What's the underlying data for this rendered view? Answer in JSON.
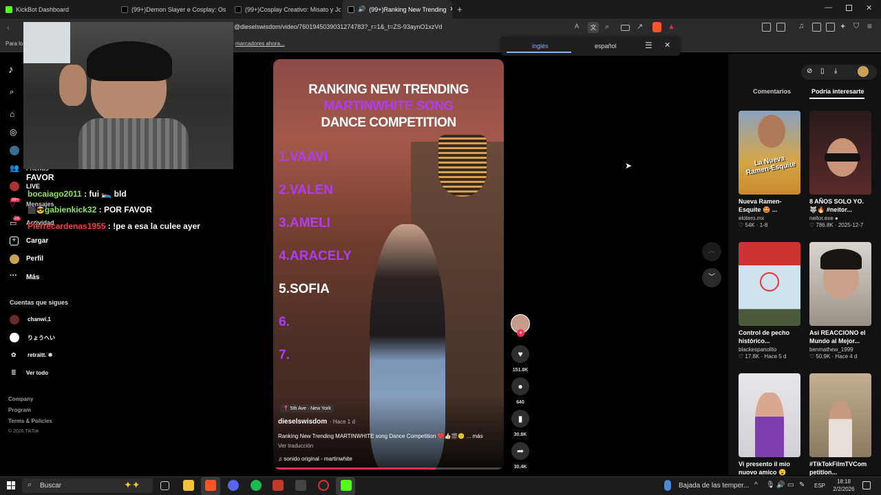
{
  "tabs": [
    {
      "label": "KickBot Dashboard"
    },
    {
      "label": "(99+)Demon Slayer e Cosplay: Os Fa"
    },
    {
      "label": "(99+)Cosplay Creativo: Misato y Jolyr"
    },
    {
      "label": "(99+)Ranking New Trending"
    }
  ],
  "address": {
    "url": "@dieselswisdom/video/7601945039031274783?_r=1&_t=ZS-93aynO1xzVd"
  },
  "bookmarks": {
    "left": "Para lo",
    "prompt": "marcadores ahora..."
  },
  "translate": {
    "lang_from": "inglés",
    "lang_to": "español"
  },
  "left_nav": {
    "items": [
      "Friends",
      "LIVE",
      "Mensajes",
      "Actividad",
      "Cargar",
      "Perfil",
      "Más"
    ],
    "badges": [
      "99+",
      "26"
    ],
    "following_title": "Cuentas que sigues",
    "following": [
      "chanwi.1",
      "りょうへい",
      "retraitt. ❄"
    ],
    "see_all": "Ver todo",
    "footer": [
      "Company",
      "Program",
      "Terms & Policies",
      "© 2026 TikTok"
    ]
  },
  "chat": [
    {
      "user": "",
      "msg": "FAVOR",
      "color": "#ffffff"
    },
    {
      "user": "bocaiago2011",
      "msg": ": fui 🛌 bld",
      "color": "#8ae65c"
    },
    {
      "user": "gabienkick32",
      "msg": ": POR FAVOR",
      "color": "#8ae65c"
    },
    {
      "user": "Pierrecardenas1955",
      "msg": ": !pe a esa la culee ayer",
      "color": "#ff3b3b"
    }
  ],
  "video": {
    "title_lines": [
      "RANKING NEW TRENDING",
      "MARTINWHITE SONG",
      "DANCE COMPETITION"
    ],
    "ranks": [
      "1.VAAVI",
      "2.VALEN",
      "3.AMELI",
      "4.ARACELY",
      "5.SOFIA",
      "6.",
      "7."
    ],
    "location": "5th Ave · New York",
    "author": "dieselswisdom",
    "time": "· Hace 1 d",
    "caption": "Ranking New Trending MARTINWHITE song Dance Competition ❤️👍🏻🎬🙂 ... más",
    "translate_link": "Ver traducción",
    "sound": "sonido original - martinwhite",
    "progress": 0.7
  },
  "actions": {
    "likes": "151.8K",
    "comments": "640",
    "saves": "30.8K",
    "shares": "30.4K"
  },
  "right_panel": {
    "tab_comments": "Comentarios",
    "tab_suggest": "Podría interesarte",
    "cards": [
      {
        "title": "Nueva Ramen-Esquite 🤩 ...",
        "author": "elotero.mx",
        "meta": "♡ 54K · 1-8",
        "overlay": "La Nueva Ramen-Esquite"
      },
      {
        "title": "8 AÑOS SOLO YO. 🐺🔥 #neitor...",
        "author": "neitor.exe ●",
        "meta": "♡ 786.8K · 2025-12-7",
        "overlay": ""
      },
      {
        "title": "Control de pecho histórico...",
        "author": "blackespanolito",
        "meta": "♡ 17.8K · Hace 5 d",
        "overlay": ""
      },
      {
        "title": "Así REACCIONO el Mundo al Mejor...",
        "author": "benmathew_1999",
        "meta": "♡ 50.9K · Hace 4 d",
        "overlay": ""
      },
      {
        "title": "Vi presento il mio nuovo amico 😮",
        "author": "",
        "meta": "",
        "overlay": ""
      },
      {
        "title": "#TikTokFilmTVCom petition...",
        "author": "",
        "meta": "",
        "overlay": ""
      }
    ]
  },
  "taskbar": {
    "search": "Buscar",
    "weather": "Bajada de las temper...",
    "lang": "ESP",
    "time": "18:18",
    "date": "2/2/2026"
  },
  "colors": {
    "accent_purple": "#b13cf0",
    "like_red": "#fe2c55",
    "link_blue": "#8ab4f8"
  }
}
